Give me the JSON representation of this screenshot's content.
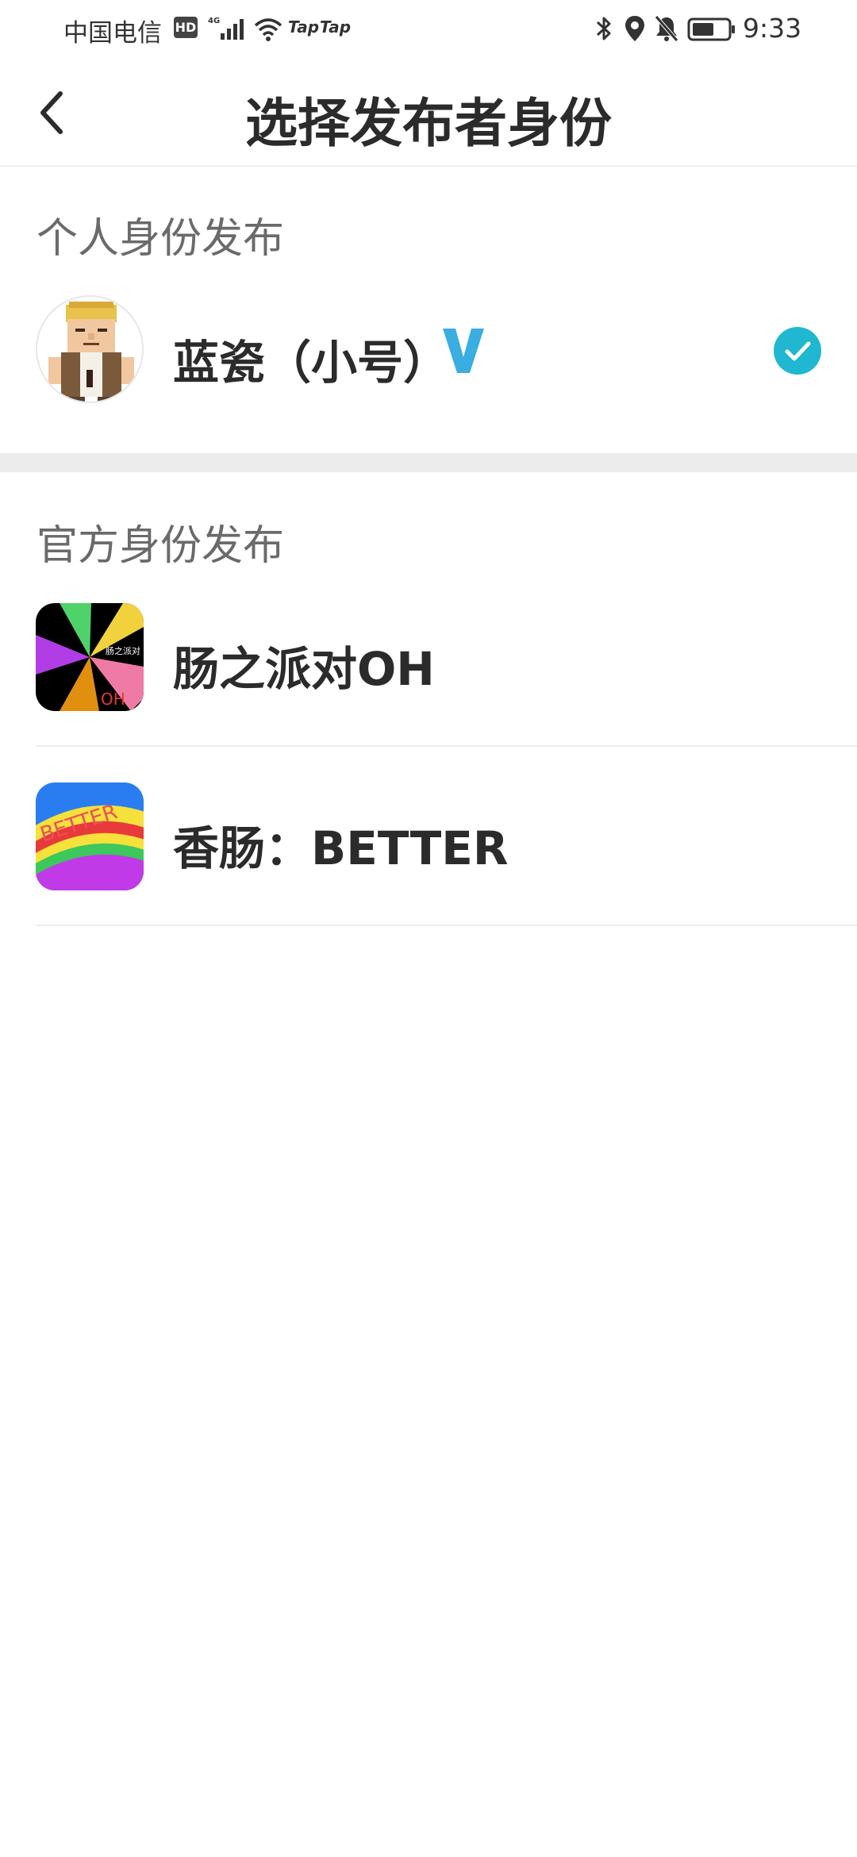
{
  "status_bar": {
    "carrier": "中国电信",
    "hd_badge": "HD",
    "network_type": "4G",
    "app_indicators": [
      "Tap",
      "Tap"
    ],
    "time": "9:33"
  },
  "header": {
    "title": "选择发布者身份",
    "back_icon": "chevron-left-icon"
  },
  "sections": {
    "personal": {
      "title": "个人身份发布",
      "items": [
        {
          "name": "蓝瓷（小号）",
          "badge": "V",
          "selected": true
        }
      ]
    },
    "official": {
      "title": "官方身份发布",
      "items": [
        {
          "name": "肠之派对OH",
          "icon_text_top": "肠之派对",
          "icon_text_bottom": "OH"
        },
        {
          "name": "香肠：BETTER",
          "icon_text": "BETTER"
        }
      ]
    }
  },
  "colors": {
    "accent": "#1fb8d0",
    "verified": "#3aaee0",
    "divider": "#ececec"
  }
}
